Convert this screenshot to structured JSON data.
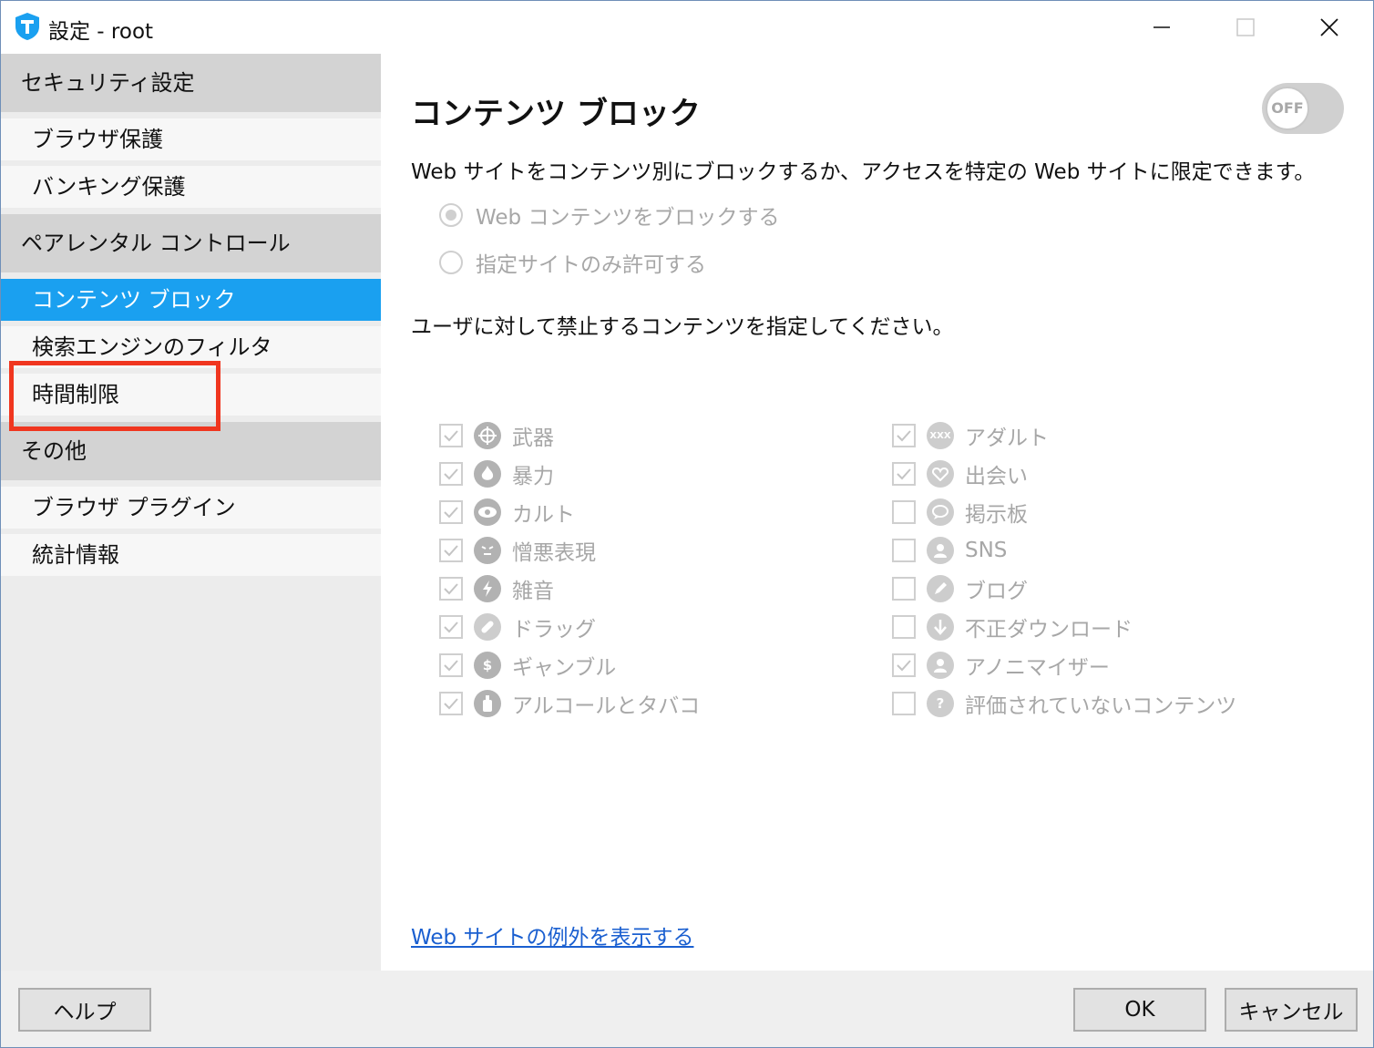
{
  "window": {
    "title": "設定 - root"
  },
  "sidebar": {
    "sections": [
      {
        "label": "セキュリティ設定",
        "items": [
          {
            "label": "ブラウザ保護"
          },
          {
            "label": "バンキング保護"
          }
        ]
      },
      {
        "label": "ペアレンタル コントロール",
        "items": [
          {
            "label": "コンテンツ ブロック"
          },
          {
            "label": "検索エンジンのフィルタ"
          },
          {
            "label": "時間制限"
          }
        ]
      },
      {
        "label": "その他",
        "items": [
          {
            "label": "ブラウザ プラグイン"
          },
          {
            "label": "統計情報"
          }
        ]
      }
    ],
    "active_item": "コンテンツ ブロック",
    "highlighted_item": "時間制限"
  },
  "main": {
    "title": "コンテンツ ブロック",
    "toggle": {
      "label": "OFF",
      "state": "off"
    },
    "description": "Web サイトをコンテンツ別にブロックするか、アクセスを特定の Web サイトに限定できます。",
    "modes": [
      {
        "label": "Web コンテンツをブロックする",
        "selected": true
      },
      {
        "label": "指定サイトのみ許可する",
        "selected": false
      }
    ],
    "instruction": "ユーザに対して禁止するコンテンツを指定してください。",
    "categories_left": [
      {
        "label": "武器",
        "checked": true,
        "icon": "crosshair-icon"
      },
      {
        "label": "暴力",
        "checked": true,
        "icon": "flame-icon"
      },
      {
        "label": "カルト",
        "checked": true,
        "icon": "eye-icon"
      },
      {
        "label": "憎悪表現",
        "checked": true,
        "icon": "angry-face-icon"
      },
      {
        "label": "雑音",
        "checked": true,
        "icon": "lightning-icon"
      },
      {
        "label": "ドラッグ",
        "checked": true,
        "icon": "pill-icon"
      },
      {
        "label": "ギャンブル",
        "checked": true,
        "icon": "dollar-icon"
      },
      {
        "label": "アルコールとタバコ",
        "checked": true,
        "icon": "bottle-icon"
      }
    ],
    "categories_right": [
      {
        "label": "アダルト",
        "checked": true,
        "icon": "xxx-icon"
      },
      {
        "label": "出会い",
        "checked": true,
        "icon": "heart-icon"
      },
      {
        "label": "掲示板",
        "checked": false,
        "icon": "chat-bubble-icon"
      },
      {
        "label": "SNS",
        "checked": false,
        "icon": "person-icon"
      },
      {
        "label": "ブログ",
        "checked": false,
        "icon": "pen-icon"
      },
      {
        "label": "不正ダウンロード",
        "checked": false,
        "icon": "download-icon"
      },
      {
        "label": "アノニマイザー",
        "checked": true,
        "icon": "anonymous-icon"
      },
      {
        "label": "評価されていないコンテンツ",
        "checked": false,
        "icon": "question-icon"
      }
    ],
    "exceptions_link": "Web サイトの例外を表示する"
  },
  "footer": {
    "help": "ヘルプ",
    "ok": "OK",
    "cancel": "キャンセル"
  },
  "colors": {
    "accent": "#1aa0f0",
    "section_bg": "#d3d3d3",
    "sidebar_bg": "#ececec",
    "highlight_border": "#f0361f",
    "link": "#1a5fd0",
    "disabled_text": "#a7a7a7"
  }
}
